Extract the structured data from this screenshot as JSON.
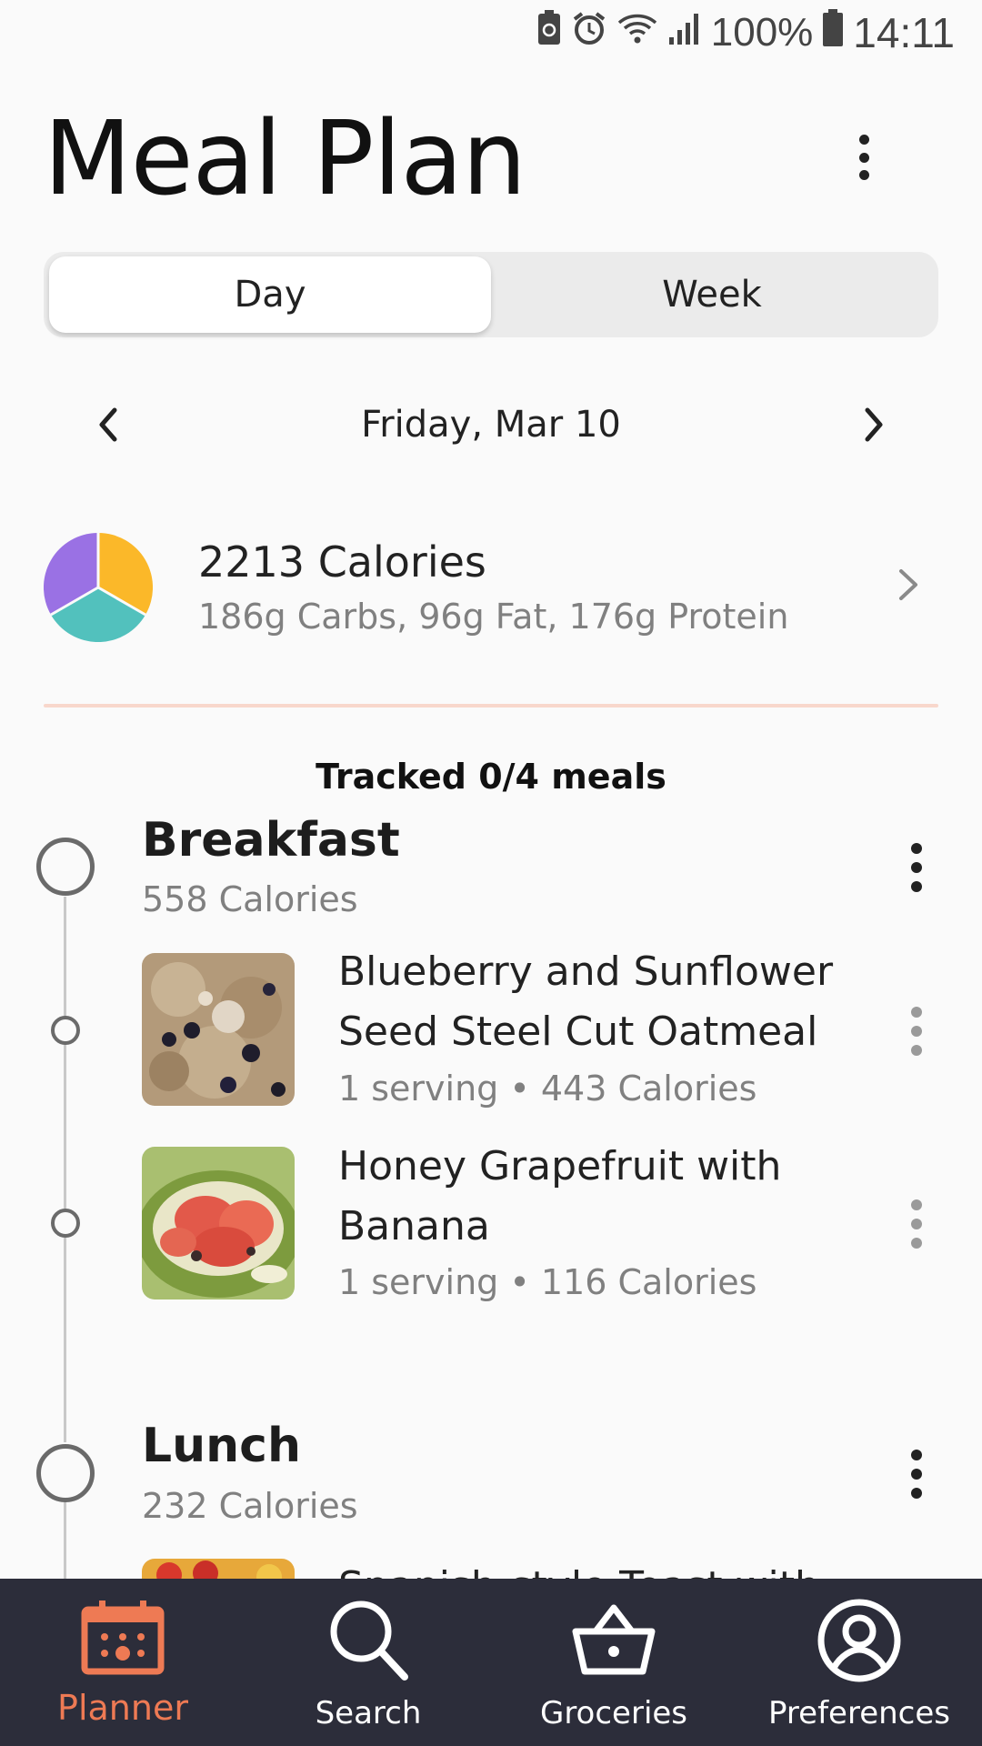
{
  "status_bar": {
    "battery": "100%",
    "time": "14:11"
  },
  "header": {
    "title": "Meal Plan",
    "menu_icon": "more-vert-icon"
  },
  "view_toggle": {
    "options": [
      "Day",
      "Week"
    ],
    "selected": "Day"
  },
  "date_nav": {
    "label": "Friday, Mar 10"
  },
  "nutrition": {
    "calories": "2213 Calories",
    "macros": "186g Carbs, 96g Fat, 176g Protein",
    "pie_colors": {
      "carbs": "#fbb829",
      "fat": "#9a71e4",
      "protein": "#52c1bd"
    }
  },
  "tracking": {
    "label": "Tracked 0/4 meals"
  },
  "meals": [
    {
      "name": "Breakfast",
      "calories": "558 Calories",
      "foods": [
        {
          "name": "Blueberry and Sunflower Seed Steel Cut Oatmeal",
          "meta": "1 serving • 443 Calories"
        },
        {
          "name": "Honey Grapefruit with Banana",
          "meta": "1 serving • 116 Calories"
        }
      ]
    },
    {
      "name": "Lunch",
      "calories": "232 Calories",
      "foods": [
        {
          "name": "Spanish-style Toast with",
          "meta": ""
        }
      ]
    }
  ],
  "bottom_nav": {
    "items": [
      {
        "label": "Planner",
        "icon": "calendar-icon",
        "active": true
      },
      {
        "label": "Search",
        "icon": "search-icon",
        "active": false
      },
      {
        "label": "Groceries",
        "icon": "basket-icon",
        "active": false
      },
      {
        "label": "Preferences",
        "icon": "user-circle-icon",
        "active": false
      }
    ],
    "active_color": "#ee7a54"
  }
}
